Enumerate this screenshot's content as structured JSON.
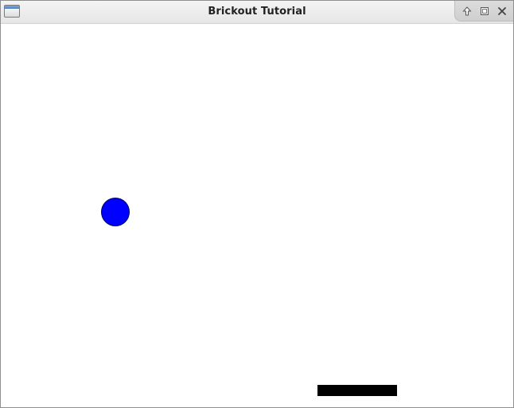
{
  "window": {
    "title": "Brickout Tutorial",
    "icons": {
      "menu": "window-menu-icon",
      "shade": "shade-arrow-up-icon",
      "maximize": "maximize-icon",
      "close": "close-icon"
    }
  },
  "game": {
    "ball_color": "#0000ff",
    "paddle_color": "#000000",
    "background_color": "#ffffff"
  }
}
